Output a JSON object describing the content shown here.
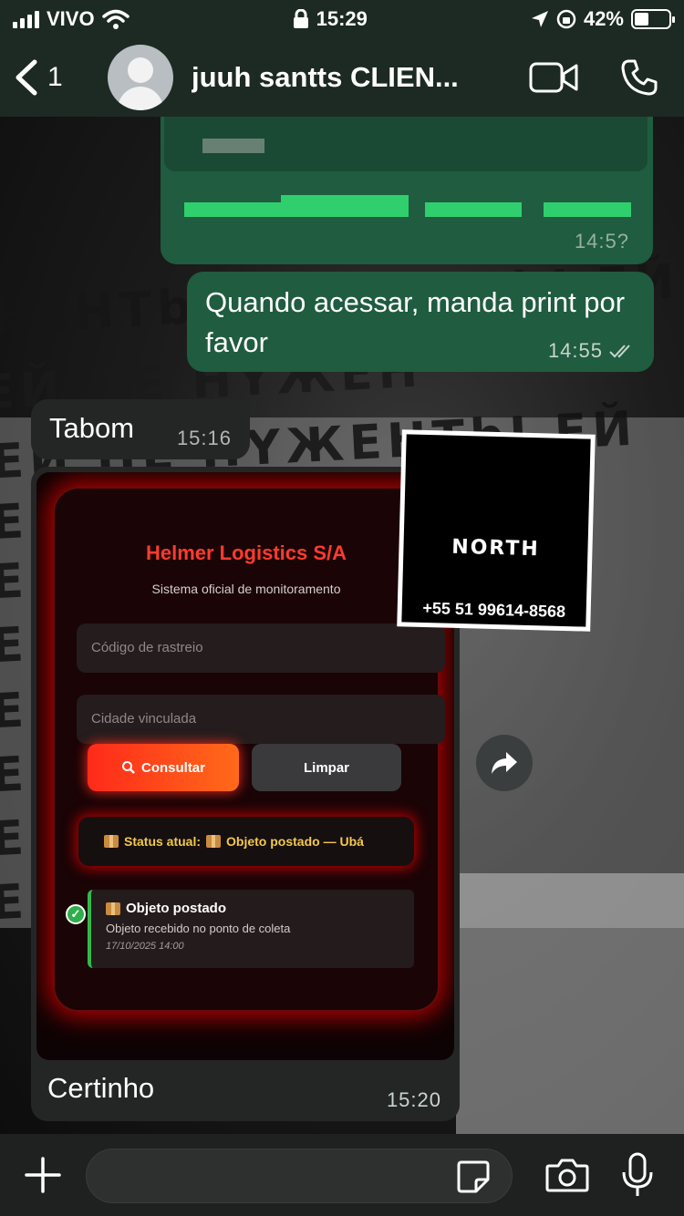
{
  "status_bar": {
    "carrier": "VIVO",
    "time": "15:29",
    "battery_percent": "42%",
    "battery_level": 0.42
  },
  "header": {
    "back_count": "1",
    "contact_name": "juuh santts CLIEN..."
  },
  "messages": [
    {
      "id": "m1",
      "direction": "outgoing",
      "text": "",
      "time": "14:5?",
      "obscured": true
    },
    {
      "id": "m2",
      "direction": "outgoing",
      "text": "Quando acessar, manda print por favor",
      "time": "14:55",
      "read": true
    },
    {
      "id": "m3",
      "direction": "incoming",
      "text": "Tabom",
      "time": "15:16"
    },
    {
      "id": "m4",
      "direction": "incoming",
      "text": "Certinho",
      "time": "15:20",
      "has_image": true
    }
  ],
  "screenshot": {
    "title": "Helmer Logistics S/A",
    "subtitle": "Sistema oficial de monitoramento",
    "tracking_placeholder": "Código de rastreio",
    "city_placeholder": "Cidade vinculada",
    "consult_label": "Consultar",
    "clear_label": "Limpar",
    "status_text": "Status atual:",
    "status_value": "Objeto postado — Ubá",
    "event_title": "Objeto postado",
    "event_desc": "Objeto recebido no ponto de coleta",
    "event_date": "17/10/2025 14:00"
  },
  "sticker": {
    "brand": "NORTH",
    "phone": "+55 51 99614-8568"
  },
  "colors": {
    "header_bg": "#1d2a24",
    "outgoing_bubble": "#1f5c40",
    "incoming_bubble": "#242626",
    "accent_red": "#ff3b30"
  }
}
